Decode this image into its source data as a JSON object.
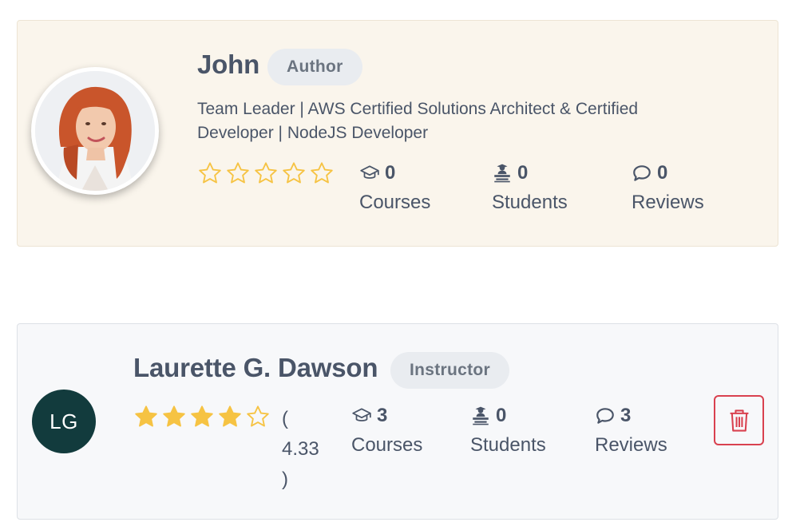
{
  "author_card": {
    "name": "John",
    "role": "Author",
    "headline": "Team Leader | AWS Certified Solutions Architect & Certified Developer | NodeJS Developer",
    "rating_filled": 0,
    "rating_max": 5,
    "stats": {
      "courses": {
        "value": "0",
        "label": "Courses"
      },
      "students": {
        "value": "0",
        "label": "Students"
      },
      "reviews": {
        "value": "0",
        "label": "Reviews"
      }
    }
  },
  "instructor_card": {
    "initials": "LG",
    "name": "Laurette G. Dawson",
    "role": "Instructor",
    "rating_filled": 4,
    "rating_max": 5,
    "rating_value": 4.33,
    "rating_text": "( 4.33 )",
    "stats": {
      "courses": {
        "value": "3",
        "label": "Courses"
      },
      "students": {
        "value": "0",
        "label": "Students"
      },
      "reviews": {
        "value": "3",
        "label": "Reviews"
      }
    }
  },
  "colors": {
    "star": "#f6c343",
    "delete": "#d9414f",
    "avatar_bg": "#123b3d",
    "author_card_bg": "#faf5ec",
    "instructor_card_bg": "#f7f8fa"
  },
  "icons": {
    "courses": "graduation-cap-icon",
    "students": "student-desk-icon",
    "reviews": "comment-icon",
    "delete": "trash-icon"
  }
}
